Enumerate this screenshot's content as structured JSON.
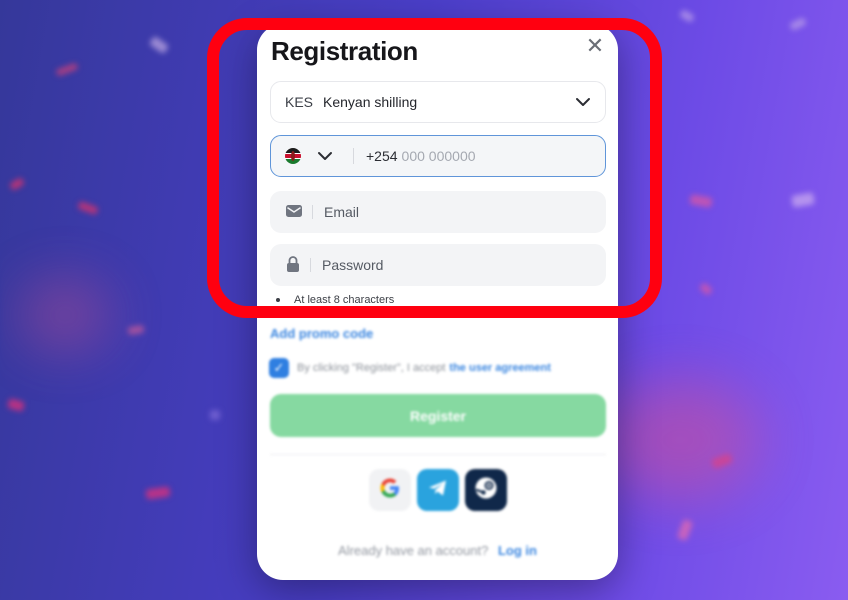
{
  "modal": {
    "title": "Registration",
    "close_symbol": "✕"
  },
  "currency": {
    "code": "KES",
    "name": "Kenyan shilling"
  },
  "phone": {
    "country_flag": "kenya-flag-icon",
    "prefix": "+254",
    "placeholder": "000 000000"
  },
  "email": {
    "placeholder": "Email"
  },
  "password": {
    "placeholder": "Password",
    "hint": "At least 8 characters"
  },
  "promo": {
    "label": "Add promo code"
  },
  "agreement": {
    "checked": true,
    "text": "By clicking \"Register\", I accept",
    "link": "the user agreement"
  },
  "register_button": {
    "label": "Register"
  },
  "socials": [
    {
      "name": "google-icon"
    },
    {
      "name": "telegram-icon"
    },
    {
      "name": "steam-icon"
    }
  ],
  "footer": {
    "text": "Already have an account?",
    "link": "Log in"
  },
  "colors": {
    "accent_blue": "#3c87e0",
    "register_green": "#86d9a1",
    "highlight_red": "#ff0010",
    "input_focus_border": "#5f95d9"
  }
}
